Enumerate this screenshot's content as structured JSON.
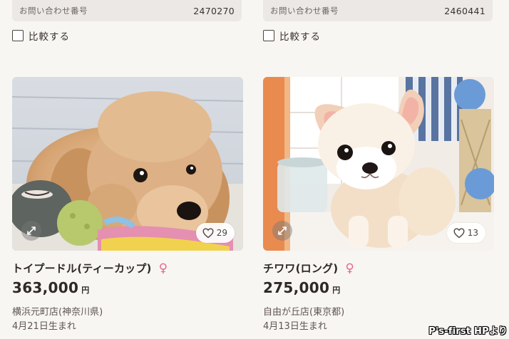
{
  "cards": [
    {
      "inquiry_label": "お問い合わせ番号",
      "inquiry_number": "2470270",
      "compare_label": "比較する",
      "breed": "トイプードル(ティーカップ)",
      "gender_symbol": "♀",
      "price": "363,000",
      "currency": "円",
      "shop": "横浜元町店(神奈川県)",
      "birth": "4月21日生まれ",
      "favorites": "29",
      "photo_icon": "toy-poodle-puppy-photo"
    },
    {
      "inquiry_label": "お問い合わせ番号",
      "inquiry_number": "2460441",
      "compare_label": "比較する",
      "breed": "チワワ(ロング)",
      "gender_symbol": "♀",
      "price": "275,000",
      "currency": "円",
      "shop": "自由が丘店(東京都)",
      "birth": "4月13日生まれ",
      "favorites": "13",
      "photo_icon": "chihuahua-puppy-photo"
    }
  ],
  "watermark": "P's-first HPより",
  "colors": {
    "background": "#f8f6f3",
    "inquiry_bar": "#ebe8e5",
    "gender_female": "#e8668a",
    "text_dark": "#2f2926"
  }
}
